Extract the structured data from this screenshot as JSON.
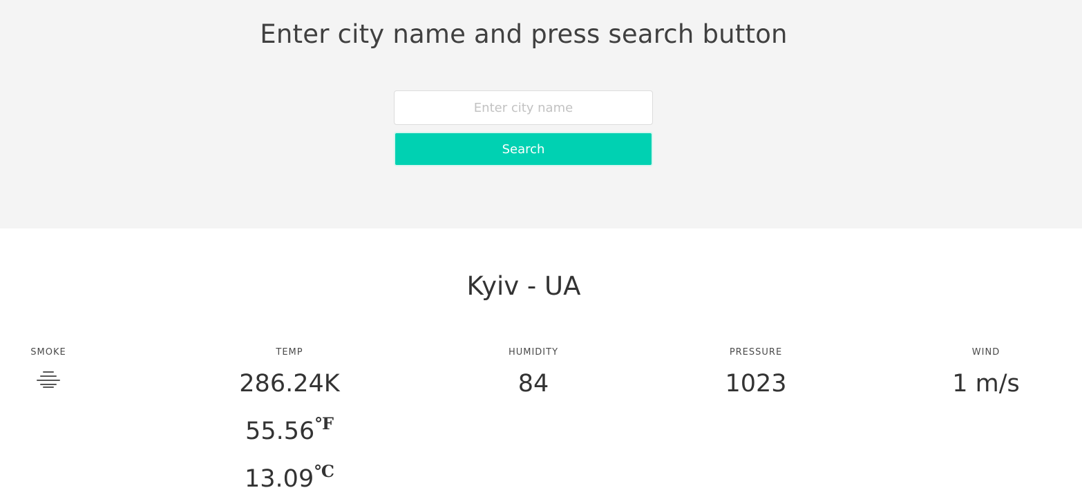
{
  "header": {
    "title": "Enter city name and press search button"
  },
  "search": {
    "placeholder": "Enter city name",
    "value": "",
    "button_label": "Search"
  },
  "location": {
    "title": "Kyiv - UA"
  },
  "stats": {
    "condition": {
      "label": "SMOKE",
      "icon": "smoke-icon"
    },
    "temp": {
      "label": "TEMP",
      "kelvin": "286.24K",
      "fahrenheit": "55.56",
      "fahrenheit_unit": "℉",
      "celsius": "13.09",
      "celsius_unit": "℃"
    },
    "humidity": {
      "label": "HUMIDITY",
      "value": "84"
    },
    "pressure": {
      "label": "PRESSURE",
      "value": "1023"
    },
    "wind": {
      "label": "WIND",
      "value": "1 m/s"
    }
  },
  "colors": {
    "hero_background": "#f4f4f4",
    "accent": "#00d1b2",
    "text": "#333333"
  }
}
